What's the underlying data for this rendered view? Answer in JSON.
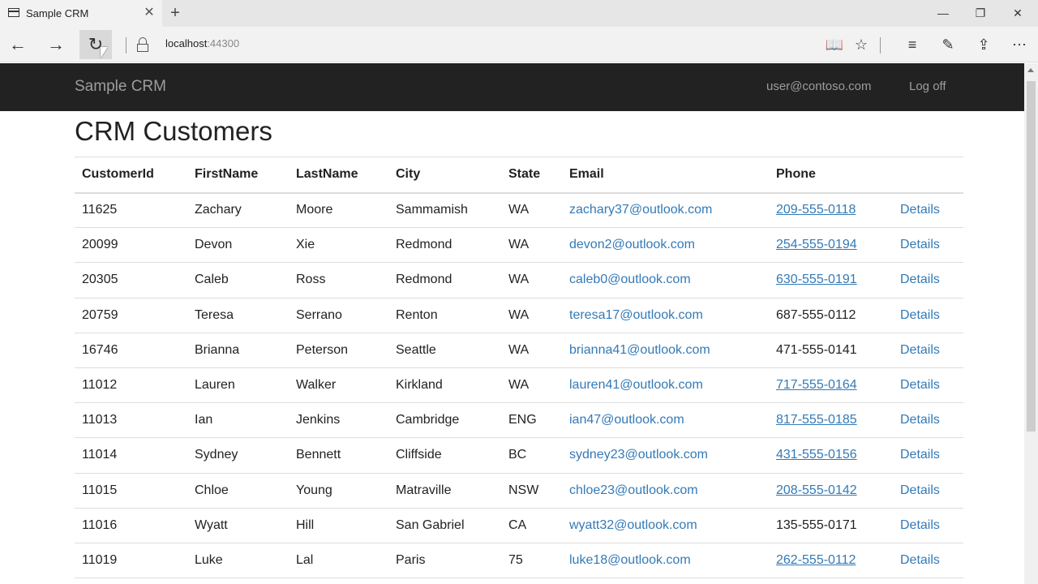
{
  "browser": {
    "tab_title": "Sample CRM",
    "tab_close": "✕",
    "new_tab": "+",
    "minimize": "—",
    "restore": "❐",
    "close": "✕",
    "url_host": "localhost",
    "url_port": ":44300",
    "icons": {
      "back": "←",
      "forward": "→",
      "refresh": "↻",
      "reading_view": "📖",
      "favorite": "☆",
      "hub": "≡",
      "web_note": "✎",
      "share": "⇪",
      "more": "⋯"
    }
  },
  "site": {
    "brand": "Sample CRM",
    "user": "user@contoso.com",
    "logoff": "Log off"
  },
  "page": {
    "title": "CRM Customers"
  },
  "table": {
    "headers": {
      "id": "CustomerId",
      "first": "FirstName",
      "last": "LastName",
      "city": "City",
      "state": "State",
      "email": "Email",
      "phone": "Phone"
    },
    "details_label": "Details",
    "rows": [
      {
        "id": "11625",
        "first": "Zachary",
        "last": "Moore",
        "city": "Sammamish",
        "state": "WA",
        "email": "zachary37@outlook.com",
        "phone": "209-555-0118",
        "phone_link": true
      },
      {
        "id": "20099",
        "first": "Devon",
        "last": "Xie",
        "city": "Redmond",
        "state": "WA",
        "email": "devon2@outlook.com",
        "phone": "254-555-0194",
        "phone_link": true
      },
      {
        "id": "20305",
        "first": "Caleb",
        "last": "Ross",
        "city": "Redmond",
        "state": "WA",
        "email": "caleb0@outlook.com",
        "phone": "630-555-0191",
        "phone_link": true
      },
      {
        "id": "20759",
        "first": "Teresa",
        "last": "Serrano",
        "city": "Renton",
        "state": "WA",
        "email": "teresa17@outlook.com",
        "phone": "687-555-0112",
        "phone_link": false
      },
      {
        "id": "16746",
        "first": "Brianna",
        "last": "Peterson",
        "city": "Seattle",
        "state": "WA",
        "email": "brianna41@outlook.com",
        "phone": "471-555-0141",
        "phone_link": false
      },
      {
        "id": "11012",
        "first": "Lauren",
        "last": "Walker",
        "city": "Kirkland",
        "state": "WA",
        "email": "lauren41@outlook.com",
        "phone": "717-555-0164",
        "phone_link": true
      },
      {
        "id": "11013",
        "first": "Ian",
        "last": "Jenkins",
        "city": "Cambridge",
        "state": "ENG",
        "email": "ian47@outlook.com",
        "phone": "817-555-0185",
        "phone_link": true
      },
      {
        "id": "11014",
        "first": "Sydney",
        "last": "Bennett",
        "city": "Cliffside",
        "state": "BC",
        "email": "sydney23@outlook.com",
        "phone": "431-555-0156",
        "phone_link": true
      },
      {
        "id": "11015",
        "first": "Chloe",
        "last": "Young",
        "city": "Matraville",
        "state": "NSW",
        "email": "chloe23@outlook.com",
        "phone": "208-555-0142",
        "phone_link": true
      },
      {
        "id": "11016",
        "first": "Wyatt",
        "last": "Hill",
        "city": "San Gabriel",
        "state": "CA",
        "email": "wyatt32@outlook.com",
        "phone": "135-555-0171",
        "phone_link": false
      },
      {
        "id": "11019",
        "first": "Luke",
        "last": "Lal",
        "city": "Paris",
        "state": "75",
        "email": "luke18@outlook.com",
        "phone": "262-555-0112",
        "phone_link": true
      }
    ]
  }
}
